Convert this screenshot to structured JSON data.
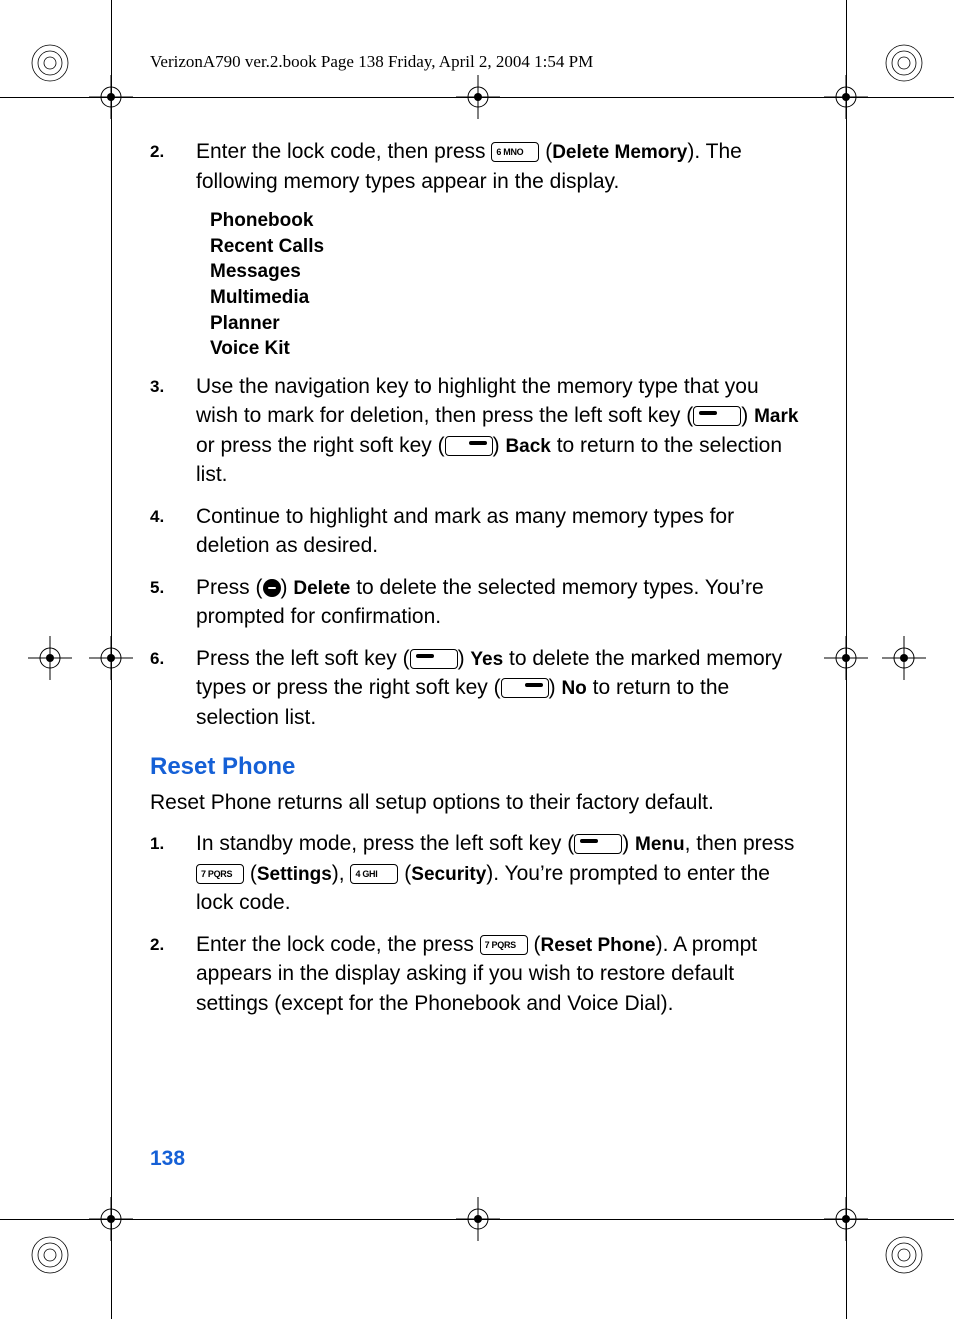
{
  "book_header": "VerizonA790 ver.2.book  Page 138  Friday, April 2, 2004  1:54 PM",
  "page_number": "138",
  "section_title": "Reset Phone",
  "reset_intro": "Reset Phone returns all setup options to their factory default.",
  "memory_types": [
    "Phonebook",
    "Recent Calls",
    "Messages",
    "Multimedia",
    "Planner",
    "Voice Kit"
  ],
  "keys": {
    "k6": "6 MNO",
    "k7": "7 PQRS",
    "k4": "4 GHI"
  },
  "labels": {
    "delete_memory": "Delete Memory",
    "mark": "Mark",
    "back": "Back",
    "delete": "Delete",
    "yes": "Yes",
    "no": "No",
    "menu": "Menu",
    "settings": "Settings",
    "security": "Security",
    "reset_phone": "Reset Phone"
  },
  "steps_a": {
    "s2": {
      "num": "2.",
      "pre": "Enter the lock code, then press ",
      "post_open": " (",
      "post_close": "). The following memory types appear in the display."
    },
    "s3": {
      "num": "3.",
      "t1": "Use the navigation key to highlight the memory type that you wish to mark for deletion, then press the left soft key (",
      "t2": ") ",
      "t3": " or press the right soft key (",
      "t4": ") ",
      "t5": " to return to the selection list."
    },
    "s4": {
      "num": "4.",
      "text": "Continue to highlight and mark as many memory types for deletion as desired."
    },
    "s5": {
      "num": "5.",
      "t1": "Press (",
      "t2": ") ",
      "t3": " to delete the selected memory types. You’re prompted for confirmation."
    },
    "s6": {
      "num": "6.",
      "t1": "Press the left soft key (",
      "t2": ") ",
      "t3": " to delete the marked memory types or press the right soft key (",
      "t4": ") ",
      "t5": " to return to the selection list."
    }
  },
  "steps_b": {
    "s1": {
      "num": "1.",
      "t1": "In standby mode, press the left soft key (",
      "t2": ") ",
      "t3": ", then press ",
      "t4": " (",
      "t5": "), ",
      "t6": " (",
      "t7": "). You’re prompted to enter the lock code."
    },
    "s2": {
      "num": "2.",
      "t1": "Enter the lock code, the press ",
      "t2": " (",
      "t3": "). A prompt appears in the display asking if you wish to restore default settings (except for the Phonebook and Voice Dial)."
    }
  }
}
